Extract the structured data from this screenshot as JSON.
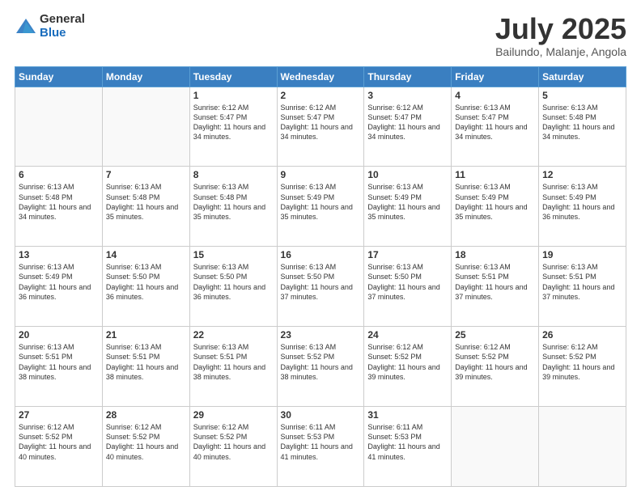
{
  "logo": {
    "general": "General",
    "blue": "Blue"
  },
  "title": "July 2025",
  "subtitle": "Bailundo, Malanje, Angola",
  "days_header": [
    "Sunday",
    "Monday",
    "Tuesday",
    "Wednesday",
    "Thursday",
    "Friday",
    "Saturday"
  ],
  "weeks": [
    [
      {
        "day": "",
        "content": ""
      },
      {
        "day": "",
        "content": ""
      },
      {
        "day": "1",
        "content": "Sunrise: 6:12 AM\nSunset: 5:47 PM\nDaylight: 11 hours and 34 minutes."
      },
      {
        "day": "2",
        "content": "Sunrise: 6:12 AM\nSunset: 5:47 PM\nDaylight: 11 hours and 34 minutes."
      },
      {
        "day": "3",
        "content": "Sunrise: 6:12 AM\nSunset: 5:47 PM\nDaylight: 11 hours and 34 minutes."
      },
      {
        "day": "4",
        "content": "Sunrise: 6:13 AM\nSunset: 5:47 PM\nDaylight: 11 hours and 34 minutes."
      },
      {
        "day": "5",
        "content": "Sunrise: 6:13 AM\nSunset: 5:48 PM\nDaylight: 11 hours and 34 minutes."
      }
    ],
    [
      {
        "day": "6",
        "content": "Sunrise: 6:13 AM\nSunset: 5:48 PM\nDaylight: 11 hours and 34 minutes."
      },
      {
        "day": "7",
        "content": "Sunrise: 6:13 AM\nSunset: 5:48 PM\nDaylight: 11 hours and 35 minutes."
      },
      {
        "day": "8",
        "content": "Sunrise: 6:13 AM\nSunset: 5:48 PM\nDaylight: 11 hours and 35 minutes."
      },
      {
        "day": "9",
        "content": "Sunrise: 6:13 AM\nSunset: 5:49 PM\nDaylight: 11 hours and 35 minutes."
      },
      {
        "day": "10",
        "content": "Sunrise: 6:13 AM\nSunset: 5:49 PM\nDaylight: 11 hours and 35 minutes."
      },
      {
        "day": "11",
        "content": "Sunrise: 6:13 AM\nSunset: 5:49 PM\nDaylight: 11 hours and 35 minutes."
      },
      {
        "day": "12",
        "content": "Sunrise: 6:13 AM\nSunset: 5:49 PM\nDaylight: 11 hours and 36 minutes."
      }
    ],
    [
      {
        "day": "13",
        "content": "Sunrise: 6:13 AM\nSunset: 5:49 PM\nDaylight: 11 hours and 36 minutes."
      },
      {
        "day": "14",
        "content": "Sunrise: 6:13 AM\nSunset: 5:50 PM\nDaylight: 11 hours and 36 minutes."
      },
      {
        "day": "15",
        "content": "Sunrise: 6:13 AM\nSunset: 5:50 PM\nDaylight: 11 hours and 36 minutes."
      },
      {
        "day": "16",
        "content": "Sunrise: 6:13 AM\nSunset: 5:50 PM\nDaylight: 11 hours and 37 minutes."
      },
      {
        "day": "17",
        "content": "Sunrise: 6:13 AM\nSunset: 5:50 PM\nDaylight: 11 hours and 37 minutes."
      },
      {
        "day": "18",
        "content": "Sunrise: 6:13 AM\nSunset: 5:51 PM\nDaylight: 11 hours and 37 minutes."
      },
      {
        "day": "19",
        "content": "Sunrise: 6:13 AM\nSunset: 5:51 PM\nDaylight: 11 hours and 37 minutes."
      }
    ],
    [
      {
        "day": "20",
        "content": "Sunrise: 6:13 AM\nSunset: 5:51 PM\nDaylight: 11 hours and 38 minutes."
      },
      {
        "day": "21",
        "content": "Sunrise: 6:13 AM\nSunset: 5:51 PM\nDaylight: 11 hours and 38 minutes."
      },
      {
        "day": "22",
        "content": "Sunrise: 6:13 AM\nSunset: 5:51 PM\nDaylight: 11 hours and 38 minutes."
      },
      {
        "day": "23",
        "content": "Sunrise: 6:13 AM\nSunset: 5:52 PM\nDaylight: 11 hours and 38 minutes."
      },
      {
        "day": "24",
        "content": "Sunrise: 6:12 AM\nSunset: 5:52 PM\nDaylight: 11 hours and 39 minutes."
      },
      {
        "day": "25",
        "content": "Sunrise: 6:12 AM\nSunset: 5:52 PM\nDaylight: 11 hours and 39 minutes."
      },
      {
        "day": "26",
        "content": "Sunrise: 6:12 AM\nSunset: 5:52 PM\nDaylight: 11 hours and 39 minutes."
      }
    ],
    [
      {
        "day": "27",
        "content": "Sunrise: 6:12 AM\nSunset: 5:52 PM\nDaylight: 11 hours and 40 minutes."
      },
      {
        "day": "28",
        "content": "Sunrise: 6:12 AM\nSunset: 5:52 PM\nDaylight: 11 hours and 40 minutes."
      },
      {
        "day": "29",
        "content": "Sunrise: 6:12 AM\nSunset: 5:52 PM\nDaylight: 11 hours and 40 minutes."
      },
      {
        "day": "30",
        "content": "Sunrise: 6:11 AM\nSunset: 5:53 PM\nDaylight: 11 hours and 41 minutes."
      },
      {
        "day": "31",
        "content": "Sunrise: 6:11 AM\nSunset: 5:53 PM\nDaylight: 11 hours and 41 minutes."
      },
      {
        "day": "",
        "content": ""
      },
      {
        "day": "",
        "content": ""
      }
    ]
  ]
}
